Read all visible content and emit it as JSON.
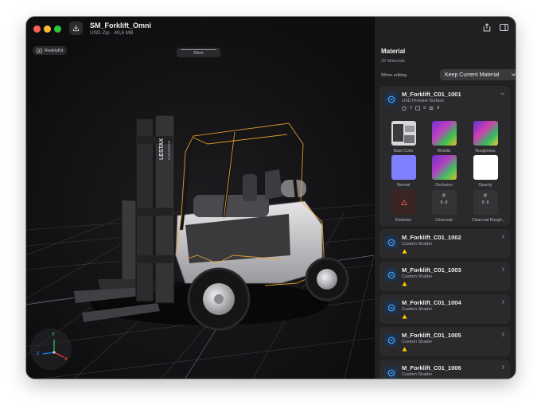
{
  "window": {
    "title": "SM_Forklift_Omni",
    "subtitle": "USD Zip · 49,6 MB"
  },
  "viewport": {
    "badge": "RealityKit",
    "scale_label": "50cm",
    "forklift_brand": "LESTAX",
    "forklift_model": "LOGISTICS",
    "axes": {
      "x": "X",
      "y": "Y",
      "z": "Z"
    }
  },
  "inspector": {
    "section_title": "Material",
    "material_count": "32 Materials",
    "when_editing_label": "When editing",
    "when_editing_value": "Keep Current Material",
    "expanded": {
      "name": "M_Forklift_C01_1001",
      "subtitle": "USD Preview Surface",
      "stat_1": "2",
      "stat_2": "9",
      "stat_3": "8",
      "textures": [
        {
          "label": "Base Color"
        },
        {
          "label": "Metallic"
        },
        {
          "label": "Roughness"
        },
        {
          "label": "Normal"
        },
        {
          "label": "Occlusion"
        },
        {
          "label": "Opacity"
        },
        {
          "label": "Emissive"
        },
        {
          "label": "Clearcoat",
          "value": "0.0"
        },
        {
          "label": "Clearcoat Rough...",
          "value": "0.0"
        }
      ]
    },
    "materials": [
      {
        "name": "M_Forklift_C01_1002",
        "subtitle": "Custom Shader"
      },
      {
        "name": "M_Forklift_C01_1003",
        "subtitle": "Custom Shader"
      },
      {
        "name": "M_Forklift_C01_1004",
        "subtitle": "Custom Shader"
      },
      {
        "name": "M_Forklift_C01_1005",
        "subtitle": "Custom Shader"
      },
      {
        "name": "M_Forklift_C01_1006",
        "subtitle": "Custom Shader"
      }
    ]
  },
  "colors": {
    "accent": "#0a84ff",
    "warning": "#ffcc00",
    "selection_outline": "#f0a530",
    "normal_map": "#7f7fff"
  },
  "icons": [
    "download-icon",
    "share-icon",
    "sidebar-icon",
    "chevron-down-icon",
    "chevron-right-icon",
    "material-icon",
    "warning-icon"
  ]
}
